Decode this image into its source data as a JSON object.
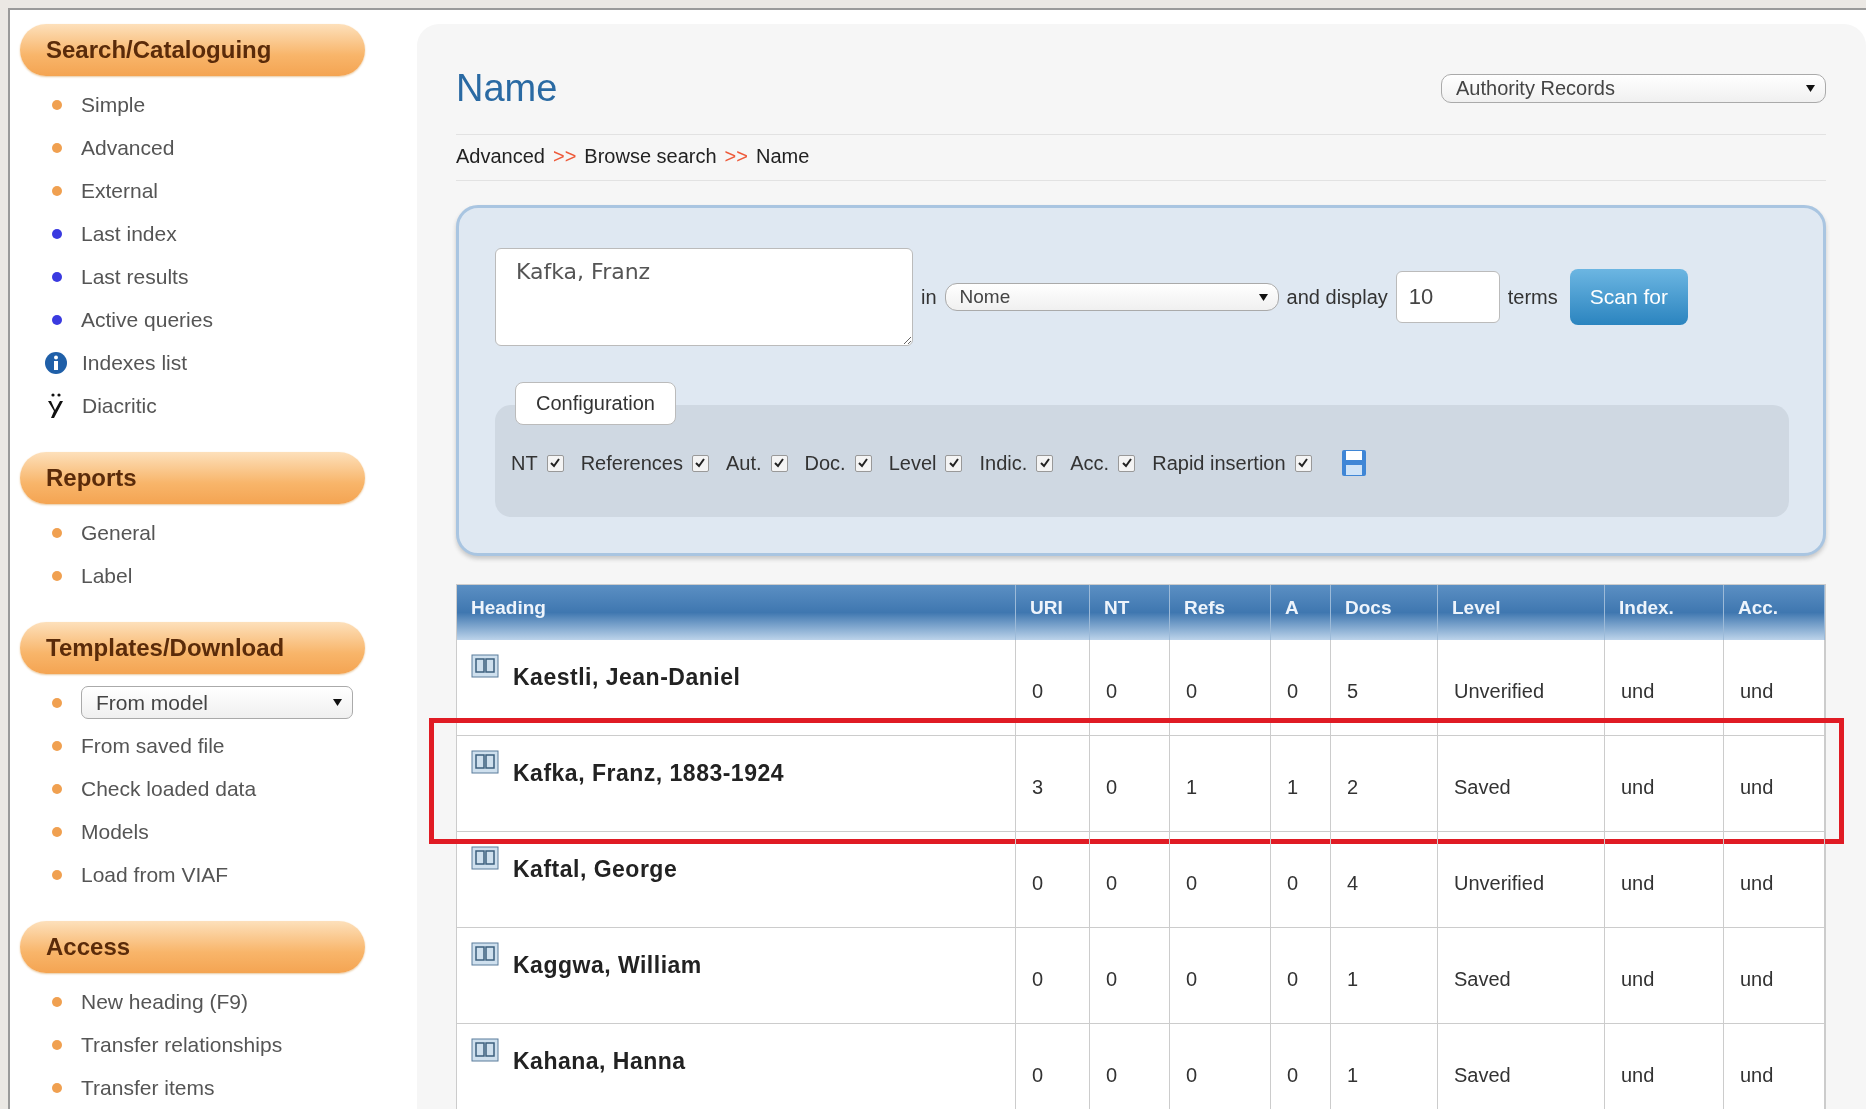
{
  "sidebar": {
    "sections": [
      {
        "title": "Search/Cataloguing",
        "items": [
          {
            "kind": "bullet",
            "color": "#f0a050",
            "label": "Simple"
          },
          {
            "kind": "bullet",
            "color": "#f0a050",
            "label": "Advanced"
          },
          {
            "kind": "bullet",
            "color": "#f0a050",
            "label": "External"
          },
          {
            "kind": "bullet",
            "color": "#3a3ae0",
            "label": "Last index"
          },
          {
            "kind": "bullet",
            "color": "#3a3ae0",
            "label": "Last results"
          },
          {
            "kind": "bullet",
            "color": "#3a3ae0",
            "label": "Active queries"
          },
          {
            "kind": "info",
            "label": "Indexes list"
          },
          {
            "kind": "diacritic",
            "label": "Diacritic"
          }
        ]
      },
      {
        "title": "Reports",
        "items": [
          {
            "kind": "bullet",
            "color": "#f0a050",
            "label": "General"
          },
          {
            "kind": "bullet",
            "color": "#f0a050",
            "label": "Label"
          }
        ]
      },
      {
        "title": "Templates/Download",
        "items": [
          {
            "kind": "select",
            "color": "#f0a050",
            "label": "From model"
          },
          {
            "kind": "bullet",
            "color": "#f0a050",
            "label": "From saved file"
          },
          {
            "kind": "bullet",
            "color": "#f0a050",
            "label": "Check loaded data"
          },
          {
            "kind": "bullet",
            "color": "#f0a050",
            "label": "Models"
          },
          {
            "kind": "bullet",
            "color": "#f0a050",
            "label": "Load from VIAF"
          }
        ]
      },
      {
        "title": "Access",
        "items": [
          {
            "kind": "bullet",
            "color": "#f0a050",
            "label": "New heading (F9)"
          },
          {
            "kind": "bullet",
            "color": "#f0a050",
            "label": "Transfer relationships"
          },
          {
            "kind": "bullet",
            "color": "#f0a050",
            "label": "Transfer items"
          }
        ]
      }
    ]
  },
  "main": {
    "title": "Name",
    "record_type": "Authority Records",
    "breadcrumb": [
      {
        "label": "Advanced",
        "separator": ">>"
      },
      {
        "label": "Browse search",
        "separator": ">>"
      },
      {
        "label": "Name"
      }
    ],
    "search": {
      "value": "Kafka, Franz",
      "in_label": "in",
      "field": "Nome",
      "display_label": "and display",
      "terms": "10",
      "terms_label": "terms",
      "button": "Scan for"
    },
    "configuration": {
      "title": "Configuration",
      "options": [
        {
          "label": "NT",
          "checked": true
        },
        {
          "label": "References",
          "checked": true
        },
        {
          "label": "Aut.",
          "checked": true
        },
        {
          "label": "Doc.",
          "checked": true
        },
        {
          "label": "Level",
          "checked": true
        },
        {
          "label": "Indic.",
          "checked": true
        },
        {
          "label": "Acc.",
          "checked": true
        },
        {
          "label": "Rapid insertion",
          "checked": true
        }
      ]
    },
    "table": {
      "columns": [
        "Heading",
        "URI",
        "NT",
        "Refs",
        "A",
        "Docs",
        "Level",
        "Index.",
        "Acc."
      ],
      "rows": [
        {
          "cells": [
            "Kaestli, Jean-Daniel",
            "0",
            "0",
            "0",
            "0",
            "5",
            "Unverified",
            "und",
            "und"
          ],
          "highlighted": false
        },
        {
          "cells": [
            "Kafka, Franz, 1883-1924",
            "3",
            "0",
            "1",
            "1",
            "2",
            "Saved",
            "und",
            "und"
          ],
          "highlighted": true
        },
        {
          "cells": [
            "Kaftal, George",
            "0",
            "0",
            "0",
            "0",
            "4",
            "Unverified",
            "und",
            "und"
          ],
          "highlighted": false
        },
        {
          "cells": [
            "Kaggwa, William",
            "0",
            "0",
            "0",
            "0",
            "1",
            "Saved",
            "und",
            "und"
          ],
          "highlighted": false
        },
        {
          "cells": [
            "Kahana, Hanna",
            "0",
            "0",
            "0",
            "0",
            "1",
            "Saved",
            "und",
            "und"
          ],
          "highlighted": false
        }
      ]
    }
  }
}
